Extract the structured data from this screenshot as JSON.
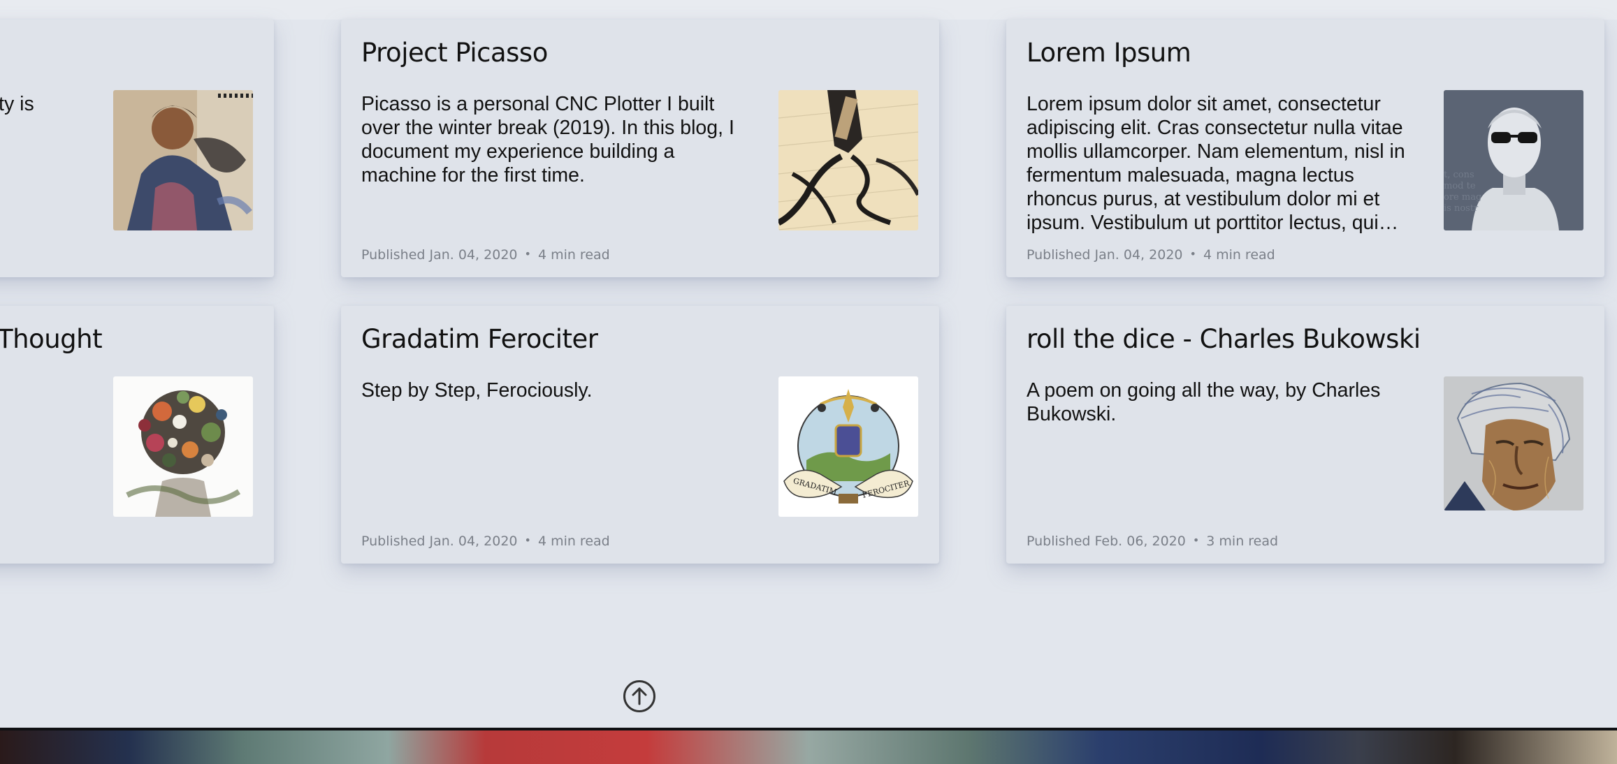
{
  "cards": [
    {
      "title": "",
      "description": "anity is",
      "published": "",
      "read_time": "",
      "thumbnail": "sketch-portrait-image"
    },
    {
      "title": "Project Picasso",
      "description": "Picasso is a personal CNC Plotter I built over the winter break (2019). In this blog, I document my experience building a machine for the first time.",
      "published": "Published Jan. 04, 2020",
      "read_time": "4 min read",
      "thumbnail": "cnc-plotter-pen-image"
    },
    {
      "title": "Lorem Ipsum",
      "description": "Lorem ipsum dolor sit amet, consectetur adipiscing elit. Cras consectetur nulla vitae mollis ullamcorper. Nam elementum, nisl in fermentum malesuada, magna lectus rhoncus purus, at vestibulum dolor mi et ipsum. Vestibulum ut porttitor lectus, qui…",
      "published": "Published Jan. 04, 2020",
      "read_time": "4 min read",
      "thumbnail": "bust-with-sunglasses-image"
    },
    {
      "title": "Thought",
      "description": "",
      "published": "",
      "read_time": "",
      "thumbnail": "floral-head-collage-image"
    },
    {
      "title": "Gradatim Ferociter",
      "description": "Step by Step, Ferociously.",
      "published": "Published Jan. 04, 2020",
      "read_time": "4 min read",
      "thumbnail": "gradatim-ferociter-crest-image",
      "thumbnail_banner_left": "GRADATIM",
      "thumbnail_banner_right": "FEROCITER"
    },
    {
      "title": "roll the dice - Charles Bukowski",
      "description": "A poem on going all the way, by Charles Bukowski.",
      "published": "Published Feb. 06, 2020",
      "read_time": "3 min read",
      "thumbnail": "bukowski-portrait-image"
    }
  ],
  "meta_separator": "•",
  "scroll_top_icon": "arrow-up-circle-icon",
  "colors": {
    "page_background": "#e2e6ed",
    "card_background": "#dfe3ea",
    "meta_text": "#7a7f88"
  }
}
